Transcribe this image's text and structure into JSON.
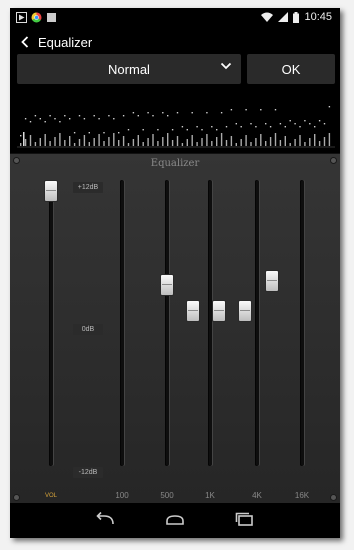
{
  "status": {
    "time": "10:45",
    "left_icons": [
      "play-store-icon",
      "chrome-icon",
      "image-icon"
    ],
    "right_icons": [
      "wifi-icon",
      "cell-signal-icon",
      "battery-icon"
    ]
  },
  "header": {
    "title": "Equalizer",
    "back_icon": "back-chevron-icon"
  },
  "toolbar": {
    "preset_value": "Normal",
    "ok_label": "OK"
  },
  "equalizer": {
    "panel_title": "Equalizer",
    "db_labels": {
      "top": "+12dB",
      "mid": "0dB",
      "bottom": "-12dB"
    },
    "bands": [
      {
        "label": "VOL",
        "level": 1.0
      },
      {
        "label": "",
        "level": 0.5
      },
      {
        "label": "100",
        "level": 0.5
      },
      {
        "label": "500",
        "level": 0.5
      },
      {
        "label": "1K",
        "level": 0.5
      },
      {
        "label": "4K",
        "level": 0.5
      },
      {
        "label": "16K",
        "level": 0.5
      }
    ]
  },
  "navbar": {
    "icons": [
      "back-icon",
      "home-icon",
      "recents-icon"
    ]
  }
}
